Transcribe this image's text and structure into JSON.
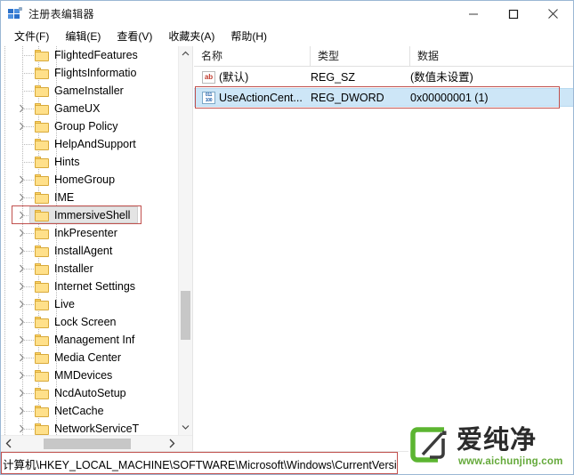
{
  "window": {
    "title": "注册表编辑器",
    "icon": "registry-icon",
    "controls": {
      "minimize": "minimize-icon",
      "maximize": "maximize-icon",
      "close": "close-icon"
    }
  },
  "menubar": {
    "items": [
      {
        "label": "文件(F)"
      },
      {
        "label": "编辑(E)"
      },
      {
        "label": "查看(V)"
      },
      {
        "label": "收藏夹(A)"
      },
      {
        "label": "帮助(H)"
      }
    ]
  },
  "tree": {
    "items": [
      {
        "label": "FlightedFeatures",
        "expandable": false,
        "selected": false,
        "indent": 0
      },
      {
        "label": "FlightsInformatio",
        "expandable": false,
        "selected": false,
        "indent": 0
      },
      {
        "label": "GameInstaller",
        "expandable": false,
        "selected": false,
        "indent": 0
      },
      {
        "label": "GameUX",
        "expandable": true,
        "selected": false,
        "indent": 0
      },
      {
        "label": "Group Policy",
        "expandable": true,
        "selected": false,
        "indent": 0
      },
      {
        "label": "HelpAndSupport",
        "expandable": false,
        "selected": false,
        "indent": 0
      },
      {
        "label": "Hints",
        "expandable": false,
        "selected": false,
        "indent": 0
      },
      {
        "label": "HomeGroup",
        "expandable": true,
        "selected": false,
        "indent": 0
      },
      {
        "label": "IME",
        "expandable": true,
        "selected": false,
        "indent": 0
      },
      {
        "label": "ImmersiveShell",
        "expandable": true,
        "selected": true,
        "indent": 0
      },
      {
        "label": "InkPresenter",
        "expandable": true,
        "selected": false,
        "indent": 0
      },
      {
        "label": "InstallAgent",
        "expandable": true,
        "selected": false,
        "indent": 0
      },
      {
        "label": "Installer",
        "expandable": true,
        "selected": false,
        "indent": 0
      },
      {
        "label": "Internet Settings",
        "expandable": true,
        "selected": false,
        "indent": 0
      },
      {
        "label": "Live",
        "expandable": true,
        "selected": false,
        "indent": 0
      },
      {
        "label": "Lock Screen",
        "expandable": true,
        "selected": false,
        "indent": 0
      },
      {
        "label": "Management Inf",
        "expandable": true,
        "selected": false,
        "indent": 0
      },
      {
        "label": "Media Center",
        "expandable": true,
        "selected": false,
        "indent": 0
      },
      {
        "label": "MMDevices",
        "expandable": true,
        "selected": false,
        "indent": 0
      },
      {
        "label": "NcdAutoSetup",
        "expandable": true,
        "selected": false,
        "indent": 0
      },
      {
        "label": "NetCache",
        "expandable": true,
        "selected": false,
        "indent": 0
      },
      {
        "label": "NetworkServiceT",
        "expandable": true,
        "selected": false,
        "indent": 0
      }
    ],
    "scrollbar": {
      "up_icon": "chevron-up-icon",
      "down_icon": "chevron-down-icon",
      "left_icon": "chevron-left-icon",
      "right_icon": "chevron-right-icon"
    }
  },
  "list": {
    "columns": [
      {
        "label": "名称"
      },
      {
        "label": "类型"
      },
      {
        "label": "数据"
      }
    ],
    "rows": [
      {
        "name": "(默认)",
        "type": "REG_SZ",
        "data": "(数值未设置)",
        "icon": "string-value-icon",
        "icon_text": "ab",
        "selected": false
      },
      {
        "name": "UseActionCent...",
        "type": "REG_DWORD",
        "data": "0x00000001 (1)",
        "icon": "dword-value-icon",
        "icon_text": "011 100",
        "selected": true
      }
    ]
  },
  "statusbar": {
    "path": "计算机\\HKEY_LOCAL_MACHINE\\SOFTWARE\\Microsoft\\Windows\\CurrentVersi"
  },
  "watermark": {
    "name": "爱纯净",
    "url": "www.aichunjing.com"
  },
  "colors": {
    "accent": "#2a6fc9",
    "selection": "#cde6f7",
    "annotation": "#c0504d",
    "folder": "#ffe08a",
    "watermark_green": "#64a93a"
  }
}
